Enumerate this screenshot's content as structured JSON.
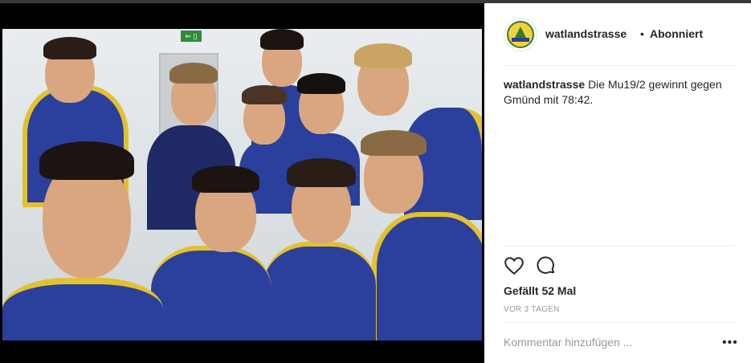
{
  "post": {
    "username": "watlandstrasse",
    "separator": "•",
    "follow_status": "Abonniert",
    "caption_user": "watlandstrasse",
    "caption_text": "Die Mu19/2 gewinnt gegen Gmünd mit 78:42.",
    "likes": "Gefällt 52 Mal",
    "age": "VOR 3 TAGEN",
    "comment_placeholder": "Kommentar hinzufügen ...",
    "more_label": "•••",
    "exit_sign": "⇐ ▯"
  },
  "icons": {
    "like": "heart-icon",
    "comment": "comment-bubble-icon",
    "more": "more-options-icon"
  },
  "colors": {
    "jersey_blue": "#2b3f9c",
    "jersey_yellow": "#e2c12f",
    "text": "#262626",
    "muted": "#999999"
  }
}
